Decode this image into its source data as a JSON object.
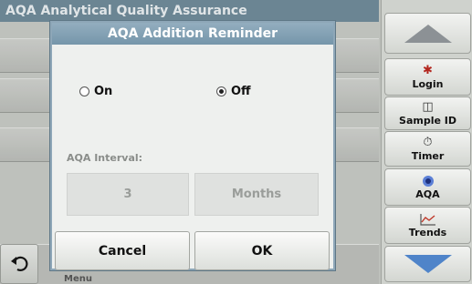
{
  "background": {
    "title": "AQA   Analytical Quality Assurance",
    "menu_label": "Menu"
  },
  "sidebar": {
    "items": [
      {
        "label": "",
        "icon": "up-arrow-icon"
      },
      {
        "label": "Login",
        "icon": "login-person-icon"
      },
      {
        "label": "Sample ID",
        "icon": "sample-vial-icon"
      },
      {
        "label": "Timer",
        "icon": "timer-icon"
      },
      {
        "label": "AQA",
        "icon": "aqa-icon"
      },
      {
        "label": "Trends",
        "icon": "trends-chart-icon"
      },
      {
        "label": "",
        "icon": "down-arrow-icon"
      }
    ]
  },
  "dialog": {
    "title": "AQA Addition Reminder",
    "on_label": "On",
    "off_label": "Off",
    "selected": "Off",
    "interval_label": "AQA Interval:",
    "interval_value": "3",
    "interval_unit": "Months",
    "cancel_label": "Cancel",
    "ok_label": "OK"
  },
  "colors": {
    "title_bar": "#6f8b9b",
    "dialog_title": "#7f9db0",
    "accent_blue": "#5b7fd6"
  }
}
